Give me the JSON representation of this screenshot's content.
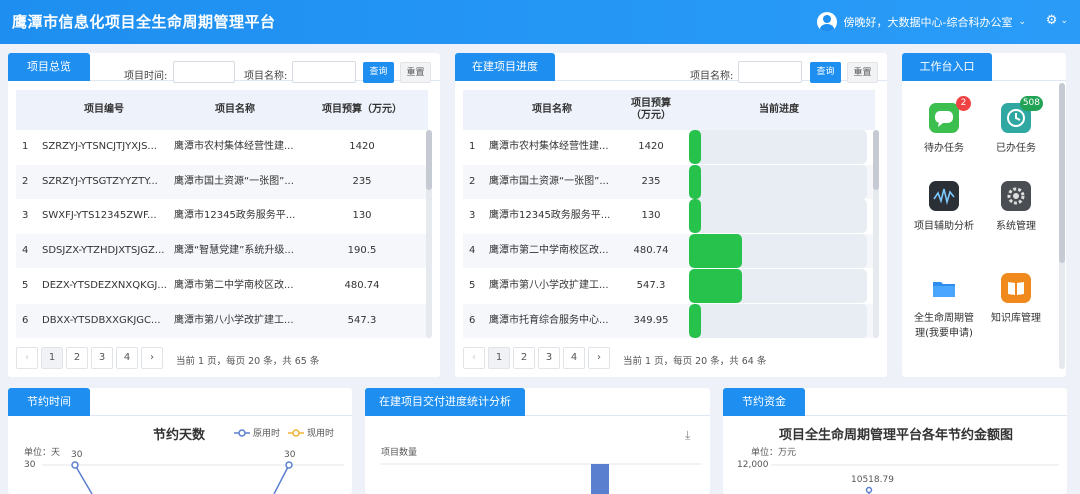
{
  "header": {
    "title": "鹰潭市信息化项目全生命周期管理平台",
    "user_greeting": "傍晚好，大数据中心-综合科办公室",
    "settings_icon": "gear-icon"
  },
  "overview": {
    "tab": "项目总览",
    "filter_time_label": "项目时间:",
    "filter_name_label": "项目名称:",
    "query_label": "查询",
    "reset_label": "重置",
    "columns": [
      "项目编号",
      "项目名称",
      "项目预算（万元）"
    ],
    "rows": [
      {
        "no": "1",
        "code": "SZRZYJ-YTSNCJTJYXJS...",
        "name": "鹰潭市农村集体经营性建...",
        "budget": "1420"
      },
      {
        "no": "2",
        "code": "SZRZYJ-YTSGTZYYZTY...",
        "name": "鹰潭市国土资源“一张图”...",
        "budget": "235"
      },
      {
        "no": "3",
        "code": "SWXFJ-YTS12345ZWF...",
        "name": "鹰潭市12345政务服务平...",
        "budget": "130"
      },
      {
        "no": "4",
        "code": "SDSJZX-YTZHDJXTSJGZ...",
        "name": "鹰潭“智慧党建”系统升级...",
        "budget": "190.5"
      },
      {
        "no": "5",
        "code": "DEZX-YTSDEZXNXQKGJ...",
        "name": "鹰潭市第二中学南校区改...",
        "budget": "480.74"
      },
      {
        "no": "6",
        "code": "DBXX-YTSDBXXGKJGC...",
        "name": "鹰潭市第八小学改扩建工...",
        "budget": "547.3"
      }
    ],
    "pages": [
      "1",
      "2",
      "3",
      "4"
    ],
    "prev": "‹",
    "next": "›",
    "info": "当前  1  页，每页  20  条，共 65 条"
  },
  "progress": {
    "tab": "在建项目进度",
    "filter_name_label": "项目名称:",
    "query_label": "查询",
    "reset_label": "重置",
    "columns": [
      "项目名称",
      "项目预算（万元）",
      "当前进度"
    ],
    "rows": [
      {
        "no": "1",
        "name": "鹰潭市农村集体经营性建...",
        "budget": "1420",
        "progress": 0.07
      },
      {
        "no": "2",
        "name": "鹰潭市国土资源“一张图”...",
        "budget": "235",
        "progress": 0.07
      },
      {
        "no": "3",
        "name": "鹰潭市12345政务服务平...",
        "budget": "130",
        "progress": 0.07
      },
      {
        "no": "4",
        "name": "鹰潭市第二中学南校区改...",
        "budget": "480.74",
        "progress": 0.3
      },
      {
        "no": "5",
        "name": "鹰潭市第八小学改扩建工...",
        "budget": "547.3",
        "progress": 0.3
      },
      {
        "no": "6",
        "name": "鹰潭市托育综合服务中心...",
        "budget": "349.95",
        "progress": 0.07
      }
    ],
    "pages": [
      "1",
      "2",
      "3",
      "4"
    ],
    "prev": "‹",
    "next": "›",
    "info": "当前  1  页，每页  20  条，共 64 条"
  },
  "workbench": {
    "tab": "工作台入口",
    "items": [
      {
        "label": "待办任务",
        "icon": "chat-bubble-icon",
        "badge": "2",
        "color": "#3dbf4f"
      },
      {
        "label": "已办任务",
        "icon": "clock-icon",
        "badge": "508",
        "color": "#2fa8a2"
      },
      {
        "label": "项目辅助分析",
        "icon": "chart-analysis-icon",
        "badge": "",
        "color": "#2b2f36"
      },
      {
        "label": "系统管理",
        "icon": "settings-gear-icon",
        "badge": "",
        "color": "#4a4d52"
      },
      {
        "label": "全生命周期管理(我要申请)",
        "icon": "folder-icon",
        "badge": "",
        "color": "#2e8ef0"
      },
      {
        "label": "知识库管理",
        "icon": "book-icon",
        "badge": "",
        "color": "#f08a1c"
      }
    ]
  },
  "savings_time": {
    "tab": "节约时间",
    "title": "节约天数",
    "legend": [
      "原用时",
      "现用时"
    ],
    "unit": "单位：天",
    "y_tick": "30",
    "labels": [
      "30",
      "30"
    ]
  },
  "delivery": {
    "tab": "在建项目交付进度统计分析",
    "ylabel": "项目数量",
    "download_icon": "download-icon"
  },
  "savings_money": {
    "tab": "节约资金",
    "title": "项目全生命周期管理平台各年节约金额图",
    "unit": "单位：万元",
    "y_tick": "12,000",
    "point_label": "10518.79"
  },
  "colors": {
    "primary": "#1e8ff0",
    "progress": "#27c24c"
  }
}
